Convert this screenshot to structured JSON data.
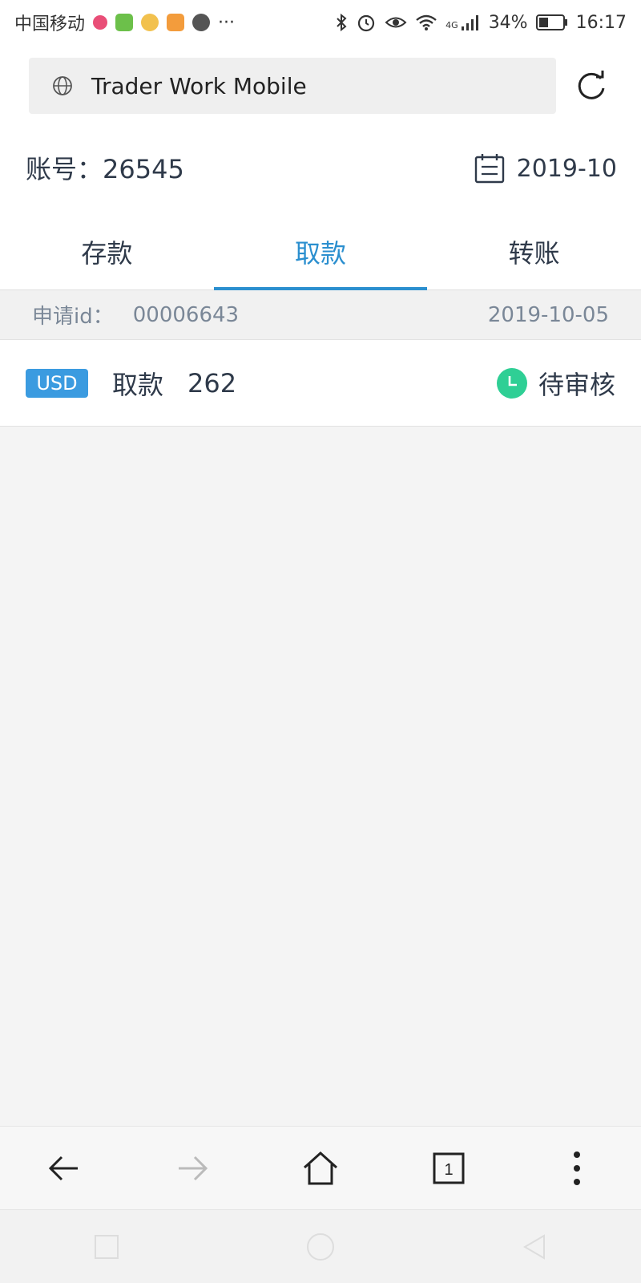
{
  "status_bar": {
    "carrier": "中国移动",
    "dots": "···",
    "network": "4G",
    "battery": "34%",
    "time": "16:17"
  },
  "browser": {
    "url": "Trader Work Mobile"
  },
  "account": {
    "label": "账号：",
    "number": "26545",
    "month": "2019-10"
  },
  "tabs": [
    {
      "label": "存款"
    },
    {
      "label": "取款"
    },
    {
      "label": "转账"
    }
  ],
  "record": {
    "id_label": "申请id：",
    "id_value": "00006643",
    "date": "2019-10-05",
    "currency": "USD",
    "type": "取款",
    "amount": "262",
    "status": "待审核"
  },
  "colors": {
    "accent": "#2b8fcf",
    "badge": "#3b9be0",
    "status_green": "#2fcf95"
  },
  "icons": {
    "url": "globe-icon",
    "reload": "reload-icon",
    "calendar": "calendar-icon",
    "status": "clock-icon",
    "back": "back-arrow-icon",
    "forward": "forward-arrow-icon",
    "home": "home-icon",
    "tabs": "tabs-icon",
    "menu": "more-vertical-icon"
  },
  "browser_nav": {
    "tab_count": "1"
  }
}
